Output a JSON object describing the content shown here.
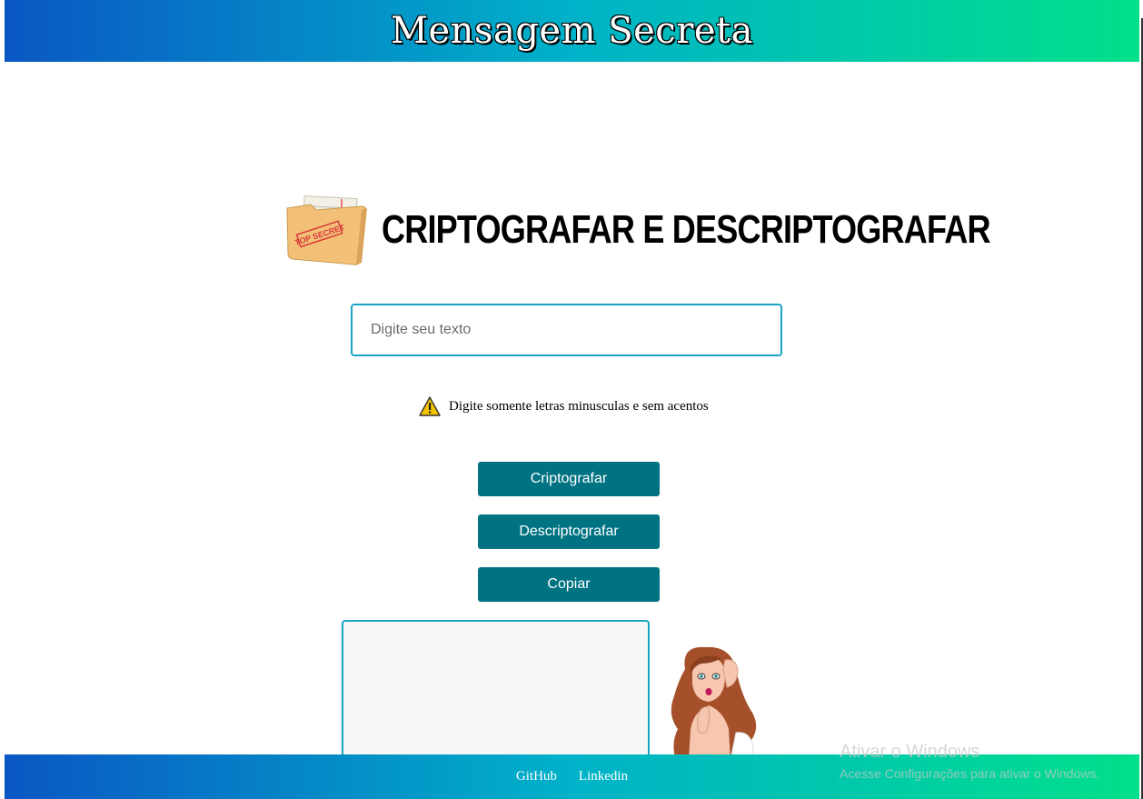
{
  "header": {
    "title": "Mensagem Secreta"
  },
  "main": {
    "headline": "CRIPTOGRAFAR E DESCRIPTOGRAFAR",
    "folder_stamp": "TOP SECRET",
    "input": {
      "placeholder": "Digite seu texto",
      "value": ""
    },
    "warning_text": "Digite somente letras minusculas e sem acentos",
    "buttons": {
      "encrypt": "Criptografar",
      "decrypt": "Descriptografar",
      "copy": "Copiar"
    },
    "output": {
      "value": ""
    }
  },
  "footer": {
    "links": [
      "GitHub",
      "Linkedin"
    ]
  },
  "watermark": {
    "title": "Ativar o Windows",
    "subtitle": "Acesse Configurações para ativar o Windows."
  },
  "colors": {
    "gradient_start": "#0a57c4",
    "gradient_mid": "#00b2c9",
    "gradient_end": "#00e08a",
    "button": "#007383",
    "border": "#1ba3c4"
  },
  "icons": {
    "folder": "top-secret-folder-icon",
    "warning": "warning-icon",
    "illustration": "whispering-woman-illustration"
  }
}
